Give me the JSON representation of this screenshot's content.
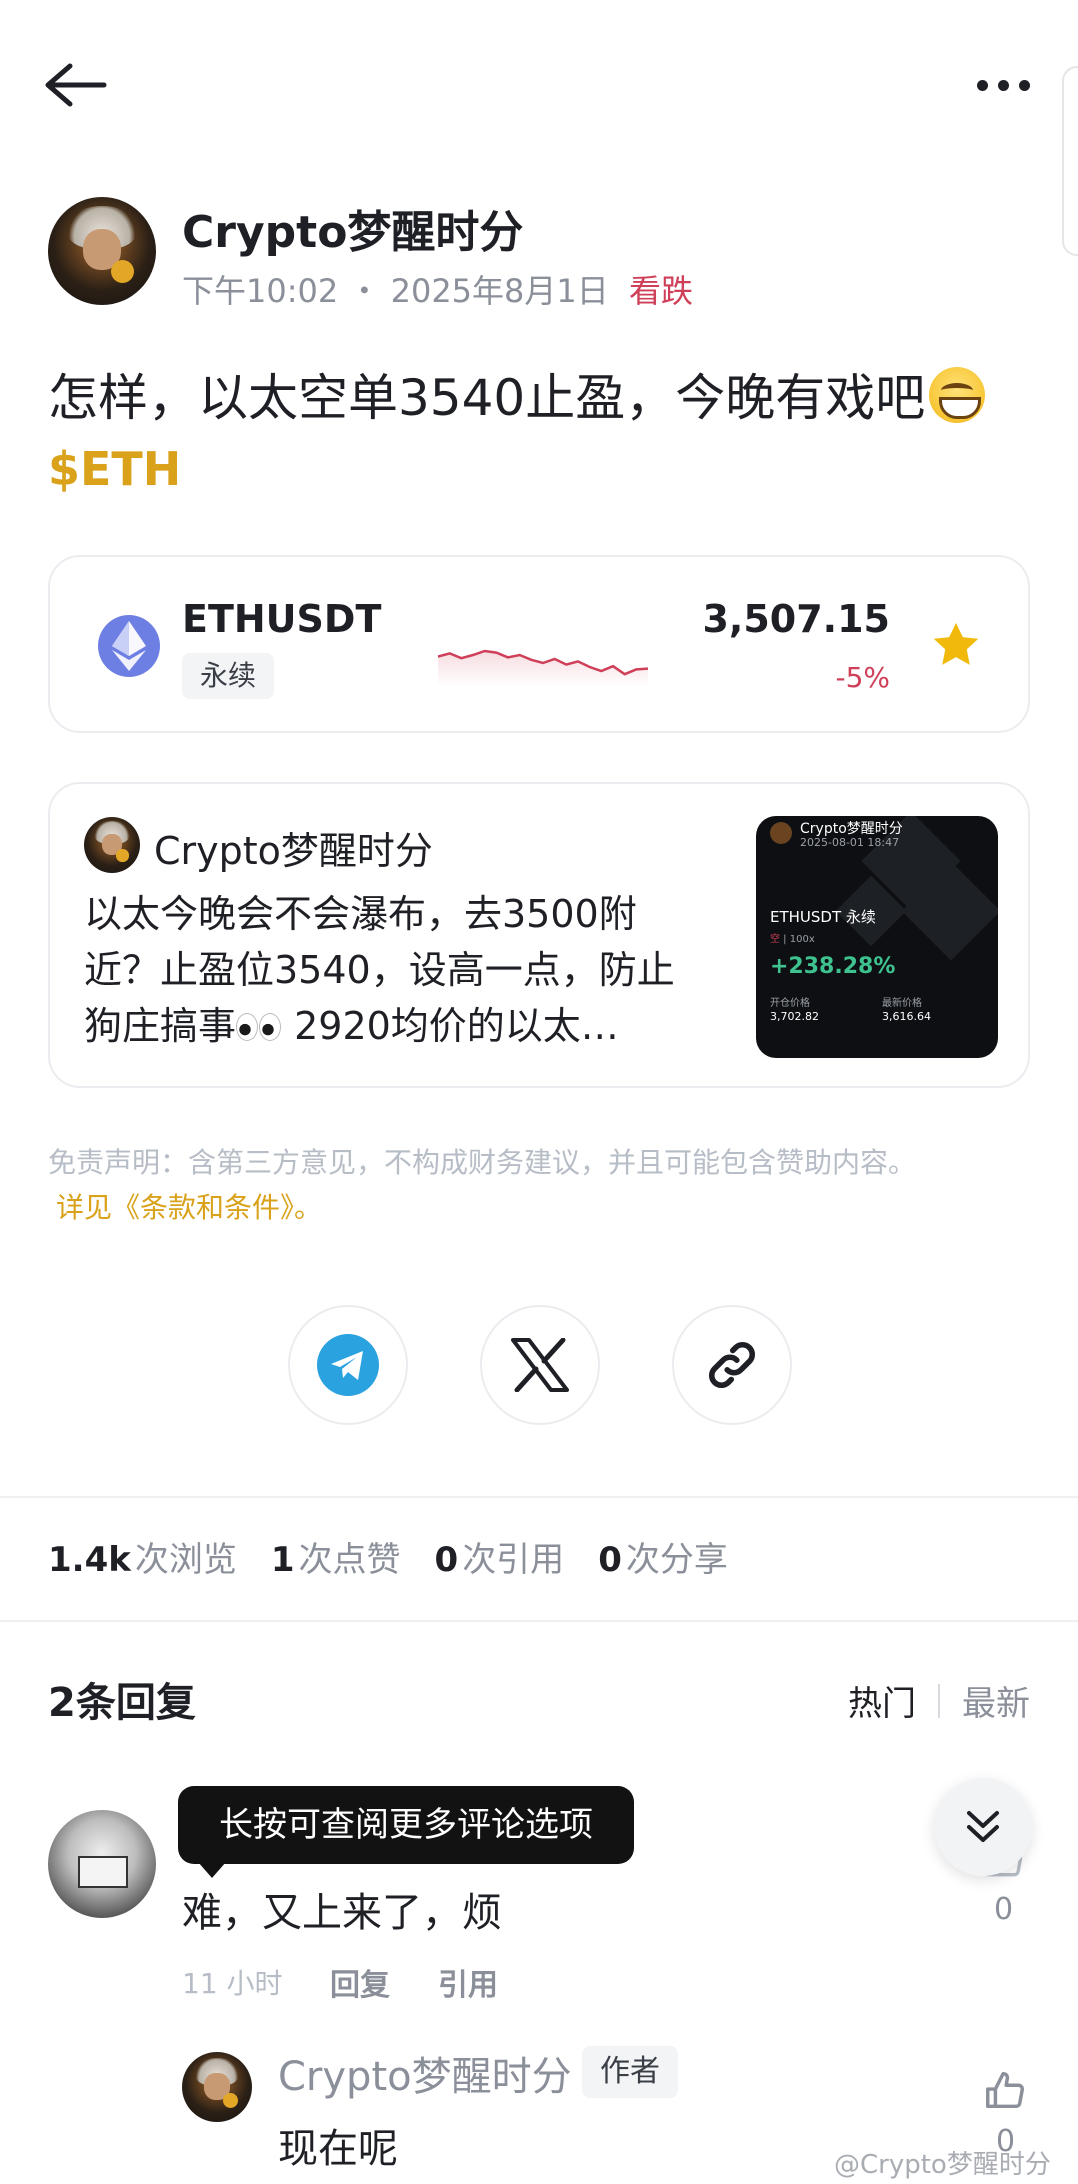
{
  "header": {
    "back_icon": "arrow-left-icon",
    "more_icon": "more-horizontal-icon"
  },
  "post": {
    "author": "Crypto梦醒时分",
    "time": "下午10:02",
    "date_sep": "・",
    "date": "2025年8月1日",
    "sentiment": "看跌",
    "text": "怎样，以太空单3540止盈，今晚有戏吧",
    "emoji": "grinning-face-icon",
    "cashtag": "$ETH"
  },
  "ticker": {
    "symbol": "ETHUSDT",
    "type": "永续",
    "price": "3,507.15",
    "change": "-5%",
    "sparkline": [
      62,
      58,
      64,
      60,
      55,
      57,
      63,
      60,
      66,
      70,
      65,
      72,
      68,
      75,
      80,
      74,
      84,
      78,
      77
    ],
    "colors": {
      "down": "#cf3f58",
      "star": "#f0b90b",
      "cashtag": "#d9a21a"
    }
  },
  "quoted_post": {
    "author": "Crypto梦醒时分",
    "text_part1": "以太今晚会不会瀑布，去3500附近？止盈位3540，设高一点，防止狗庄搞事",
    "text_part2": " 2920均价的以太…",
    "thumbnail": {
      "author": "Crypto梦醒时分",
      "datetime": "2025-08-01 18:47",
      "symbol": "ETHUSDT 永续",
      "leverage": "100x",
      "pnl": "+238.28%",
      "open_label": "开仓价格",
      "open_price": "3,702.82",
      "last_label": "最新价格",
      "last_price": "3,616.64"
    }
  },
  "disclaimer": {
    "text": "免责声明：含第三方意见，不构成财务建议，并且可能包含赞助内容。",
    "link": "详见《条款和条件》。"
  },
  "share": {
    "telegram_icon": "telegram-icon",
    "x_icon": "x-logo-icon",
    "link_icon": "link-icon"
  },
  "stats": [
    {
      "value": "1.4k",
      "label": "次浏览"
    },
    {
      "value": "1",
      "label": "次点赞"
    },
    {
      "value": "0",
      "label": "次引用"
    },
    {
      "value": "0",
      "label": "次分享"
    }
  ],
  "replies": {
    "title": "2条回复",
    "sort_hot": "热门",
    "sort_new": "最新",
    "tooltip": "长按可查阅更多评论选项",
    "comments": [
      {
        "text": "难，又上来了，烦",
        "time": "11 小时",
        "reply_label": "回复",
        "quote_label": "引用",
        "likes": "0"
      },
      {
        "author": "Crypto梦醒时分",
        "badge": "作者",
        "text": "现在呢",
        "likes": "0"
      }
    ]
  },
  "watermark": "@Crypto梦醒时分"
}
